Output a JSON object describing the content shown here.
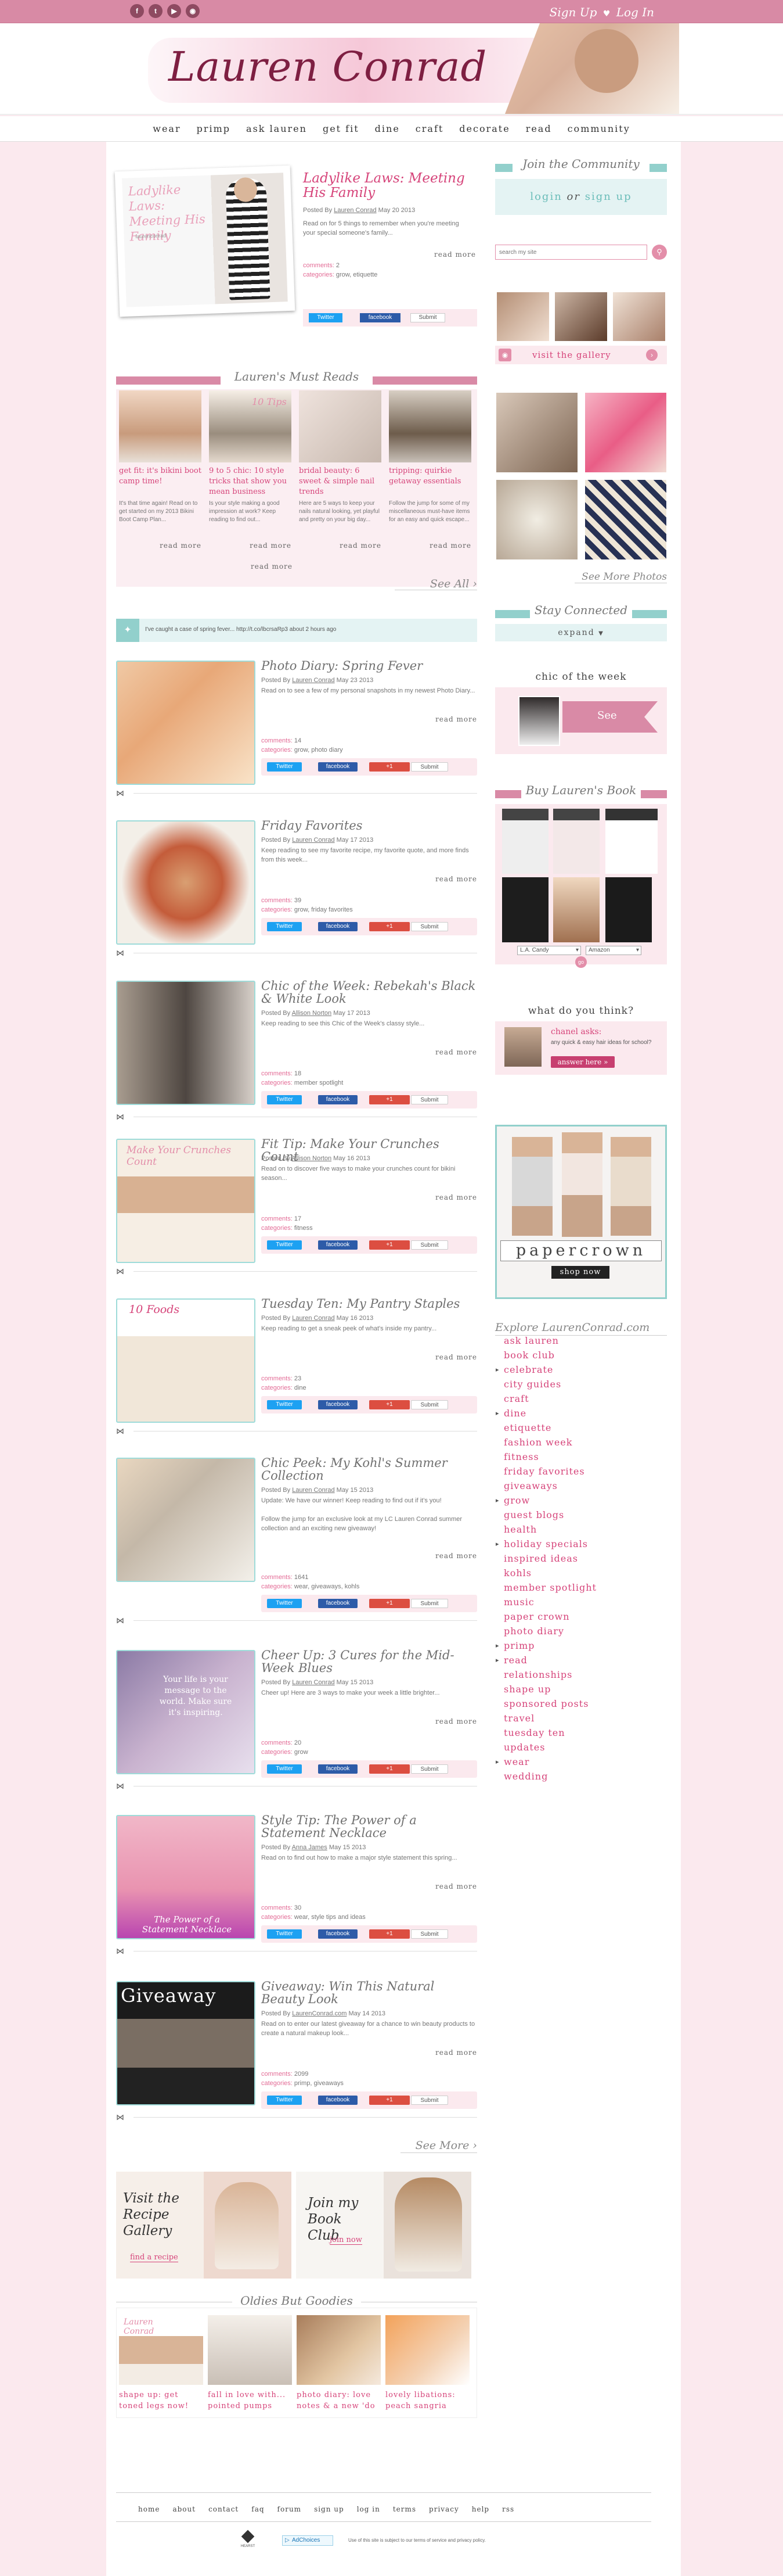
{
  "topbar": {
    "signup": "Sign Up",
    "login": "Log In"
  },
  "brand": {
    "logo": "Lauren Conrad"
  },
  "nav": [
    "wear",
    "primp",
    "ask lauren",
    "get fit",
    "dine",
    "craft",
    "decorate",
    "read",
    "community"
  ],
  "featured": {
    "image_title": "Ladylike Laws: Meeting His Family",
    "image_sub": "laurenconrad",
    "title": "Ladylike Laws: Meeting His Family",
    "posted": "Posted By",
    "author": "Lauren Conrad",
    "date": "May 20 2013",
    "excerpt": "Read on for 5 things to remember when you're meeting your special someone's family...",
    "more": "read more",
    "comments": "2",
    "categories": "grow, etiquette"
  },
  "labels": {
    "comments": "comments:",
    "categories": "categories:",
    "twitter": "Twitter",
    "facebook": "facebook",
    "google": "+1",
    "submit": "Submit",
    "submit2": "Submit"
  },
  "must_reads": {
    "heading": "Lauren's Must Reads",
    "items": [
      {
        "title": "get fit: it's bikini boot camp time!",
        "text": "It's that time again! Read on to get started on my 2013 Bikini Boot Camp Plan...",
        "more": "read more",
        "img_caption": ""
      },
      {
        "title": "9 to 5 chic: 10 style tricks that show you mean business",
        "text": "Is your style making a good impression at work? Keep reading to find out...",
        "more": "read more",
        "img_caption": "10 Tips"
      },
      {
        "title": "bridal beauty: 6 sweet & simple nail trends",
        "text": "Here are 5 ways to keep your nails natural looking, yet playful and pretty on your big day...",
        "more": "read more",
        "img_caption": ""
      },
      {
        "title": "tripping: quirkie getaway essentials",
        "text": "Follow the jump for some of my miscellaneous must-have items for an easy and quick escape...",
        "more": "read more",
        "img_caption": ""
      }
    ],
    "see_all": "See All"
  },
  "tweet": "I've caught a case of spring fever... http://t.co/lbcrsaRp3 about 2 hours ago",
  "posts": [
    {
      "title": "Photo Diary: Spring Fever",
      "author": "Lauren Conrad",
      "date": "May 23 2013",
      "excerpt": "Read on to see a few of my personal snapshots in my newest Photo Diary...",
      "more": "read more",
      "comments": "14",
      "categories": "grow, photo diary",
      "img_text": ""
    },
    {
      "title": "Friday Favorites",
      "author": "Lauren Conrad",
      "date": "May 17 2013",
      "excerpt": "Keep reading to see my favorite recipe, my favorite quote, and more finds from this week...",
      "more": "read more",
      "comments": "39",
      "categories": "grow, friday favorites",
      "img_text": ""
    },
    {
      "title": "Chic of the Week: Rebekah's Black & White Look",
      "author": "Allison Norton",
      "date": "May 17 2013",
      "excerpt": "Keep reading to see this Chic of the Week's classy style...",
      "more": "read more",
      "comments": "18",
      "categories": "member spotlight",
      "img_text": ""
    },
    {
      "title": "Fit Tip: Make Your Crunches Count",
      "author": "Allison Norton",
      "date": "May 16 2013",
      "excerpt": "Read on to discover five ways to make your crunches count for bikini season...",
      "more": "read more",
      "comments": "17",
      "categories": "fitness",
      "img_text": "Make Your Crunches Count"
    },
    {
      "title": "Tuesday Ten: My Pantry Staples",
      "author": "Lauren Conrad",
      "date": "May 16 2013",
      "excerpt": "Keep reading to get a sneak peek of what's inside my pantry...",
      "more": "read more",
      "comments": "23",
      "categories": "dine",
      "img_text": "10 Foods"
    },
    {
      "title": "Chic Peek: My Kohl's Summer Collection",
      "author": "Lauren Conrad",
      "date": "May 15 2013",
      "excerpt": "Update: We have our winner! Keep reading to find out if it's you!\n\nFollow the jump for an exclusive look at my LC Lauren Conrad summer collection and an exciting new giveaway!",
      "more": "read more",
      "comments": "1641",
      "categories": "wear, giveaways, kohls",
      "img_text": ""
    },
    {
      "title": "Cheer Up: 3 Cures for the Mid-Week Blues",
      "author": "Lauren Conrad",
      "date": "May 15 2013",
      "excerpt": "Cheer up! Here are 3 ways to make your week a little brighter...",
      "more": "read more",
      "comments": "20",
      "categories": "grow",
      "img_text": "Your life is your message to the world. Make sure it's inspiring."
    },
    {
      "title": "Style Tip: The Power of a Statement Necklace",
      "author": "Anna James",
      "date": "May 15 2013",
      "excerpt": "Read on to find out how to make a major style statement this spring...",
      "more": "read more",
      "comments": "30",
      "categories": "wear, style tips and ideas",
      "img_text": "The Power of a Statement Necklace"
    },
    {
      "title": "Giveaway: Win This Natural Beauty Look",
      "author": "LaurenConrad.com",
      "date": "May 14 2013",
      "excerpt": "Read on to enter our latest giveaway for a chance to win beauty products to create a natural makeup look...",
      "more": "read more",
      "comments": "2099",
      "categories": "primp, giveaways",
      "img_text": "Giveaway"
    }
  ],
  "see_more": "See More",
  "promos": {
    "recipe": "Visit the Recipe Gallery",
    "recipe_link": "find a recipe",
    "book": "Join my Book Club",
    "book_link": "join now"
  },
  "oldies": {
    "heading": "Oldies But Goodies",
    "items": [
      {
        "label": "shape up: get toned legs now!",
        "img_text": "Lauren Conrad"
      },
      {
        "label": "fall in love with... pointed pumps",
        "img_text": ""
      },
      {
        "label": "photo diary: love notes & a new 'do",
        "img_text": ""
      },
      {
        "label": "lovely libations: peach sangria",
        "img_text": ""
      }
    ]
  },
  "sidebar": {
    "join_heading": "Join the Community",
    "login": "login",
    "or": "or",
    "signup": "sign up",
    "search_placeholder": "search my site",
    "gallery_link": "visit the gallery",
    "see_more_photos": "See More Photos",
    "stay_connected": "Stay Connected",
    "expand": "expand",
    "chic_heading": "chic of the week",
    "see": "See",
    "book_heading": "Buy Lauren's Book",
    "book_select1": "L.A. Candy",
    "book_select2": "Amazon",
    "book_go": "go",
    "think_heading": "what do you think?",
    "chanel_asks": "chanel asks:",
    "question": "any quick & easy hair ideas for school?",
    "answer": "answer here",
    "papercrown_logo": "papercrown",
    "shop_now": "shop now",
    "explore_heading": "Explore LaurenConrad.com",
    "explore": [
      "ask lauren",
      "book club",
      "celebrate",
      "city guides",
      "craft",
      "dine",
      "etiquette",
      "fashion week",
      "fitness",
      "friday favorites",
      "giveaways",
      "grow",
      "guest blogs",
      "health",
      "holiday specials",
      "inspired ideas",
      "kohls",
      "member spotlight",
      "music",
      "paper crown",
      "photo diary",
      "primp",
      "read",
      "relationships",
      "shape up",
      "sponsored posts",
      "travel",
      "tuesday ten",
      "updates",
      "wear",
      "wedding"
    ],
    "explore_arrows": [
      2,
      5,
      11,
      14,
      21,
      22,
      29
    ]
  },
  "footer": {
    "links": [
      "home",
      "about",
      "contact",
      "faq",
      "forum",
      "sign up",
      "log in",
      "terms",
      "privacy",
      "help",
      "rss"
    ],
    "copyright": "Use of this site is subject to our terms of service and privacy policy.",
    "badge": "AdChoices",
    "logo": "HEARST"
  },
  "colors": {
    "pink": "#d6447a",
    "bar_pink": "#d88aa5",
    "teal": "#92d0cc",
    "bg": "#fbe9ee"
  }
}
